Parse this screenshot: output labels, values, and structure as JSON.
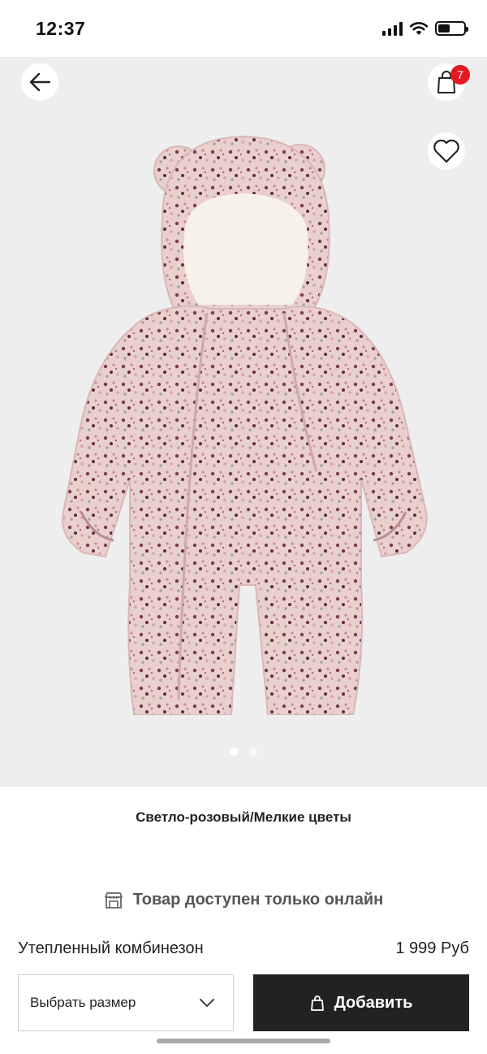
{
  "status_bar": {
    "time": "12:37",
    "battery_level": 0.45
  },
  "header": {
    "cart_count": "7"
  },
  "product": {
    "color_name": "Светло-розовый/Мелкие цветы",
    "availability_note": "Товар доступен только онлайн",
    "name": "Утепленный комбинезон",
    "price": "1 999 Руб"
  },
  "gallery": {
    "image_count": 2,
    "current_index": 0
  },
  "actions": {
    "size_select_label": "Выбрать размер",
    "add_button_label": "Добавить"
  },
  "colors": {
    "badge": "#e11b22",
    "add_button": "#222222",
    "image_background": "#efeeee",
    "garment": "#ead0cd"
  },
  "icons": [
    "back-arrow-icon",
    "shopping-bag-icon",
    "heart-icon",
    "store-icon",
    "chevron-down-icon",
    "bag-icon"
  ]
}
